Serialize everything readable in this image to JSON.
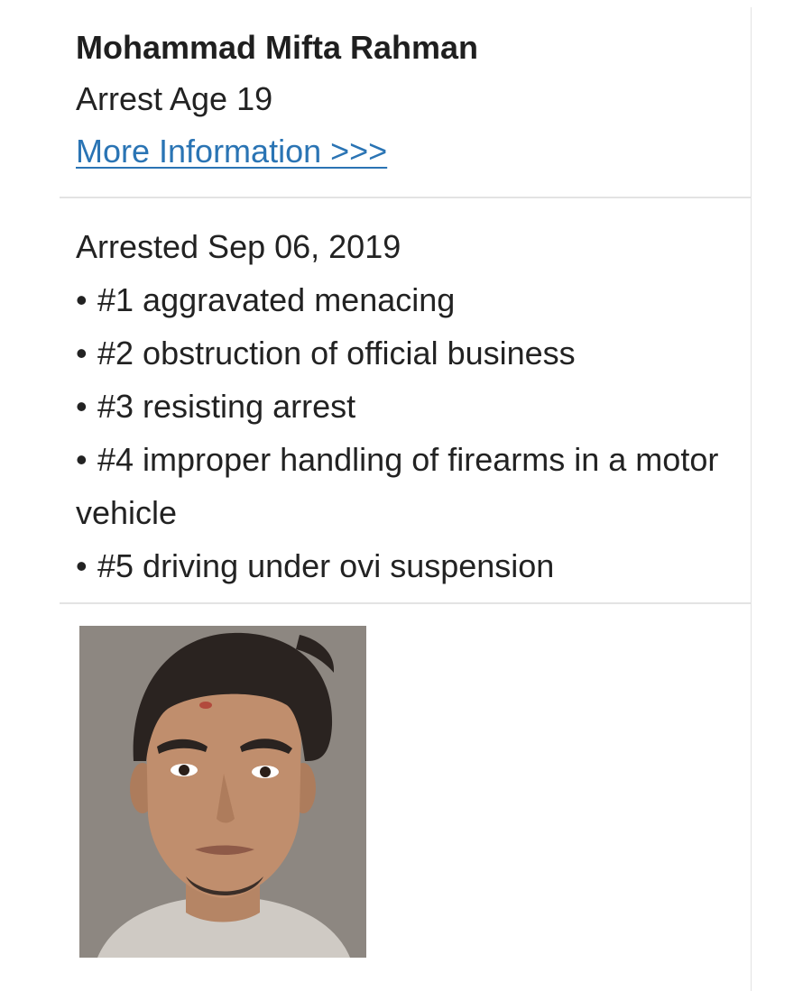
{
  "person": {
    "name": "Mohammad Mifta Rahman",
    "arrest_age_label": "Arrest Age",
    "arrest_age": "19",
    "more_info_link": "More Information >>>"
  },
  "arrest": {
    "date_text": "Arrested Sep 06, 2019",
    "bullet": "•",
    "charges": [
      "#1 aggravated menacing",
      "#2 obstruction of official business",
      "#3 resisting arrest",
      "#4 improper handling of firearms in a motor vehicle",
      "#5 driving under ovi suspension"
    ]
  },
  "photo": {
    "subject": "mugshot photo of young man"
  },
  "colors": {
    "link": "#2a74b4",
    "text": "#222222",
    "divider": "#e3e3e3",
    "photo_background": "#8d8781"
  }
}
